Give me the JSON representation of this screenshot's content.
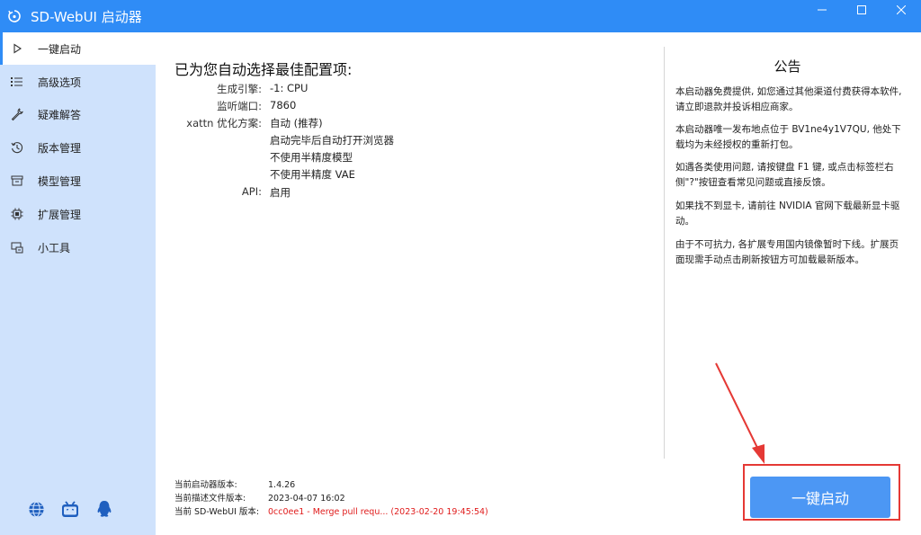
{
  "window": {
    "title": "SD-WebUI 启动器",
    "app_icon": "refresh-gear-icon",
    "controls": [
      "minimize",
      "maximize",
      "close"
    ],
    "accent_color": "#2f8cf6"
  },
  "sidebar": {
    "items": [
      {
        "label": "一键启动",
        "icon": "play-icon",
        "active": true
      },
      {
        "label": "高级选项",
        "icon": "list-icon",
        "active": false
      },
      {
        "label": "疑难解答",
        "icon": "wrench-icon",
        "active": false
      },
      {
        "label": "版本管理",
        "icon": "history-icon",
        "active": false
      },
      {
        "label": "模型管理",
        "icon": "box-icon",
        "active": false
      },
      {
        "label": "扩展管理",
        "icon": "chip-icon",
        "active": false
      },
      {
        "label": "小工具",
        "icon": "tools-icon",
        "active": false
      }
    ],
    "footer_icons": [
      "globe-icon",
      "bilibili-icon",
      "qq-icon"
    ]
  },
  "main": {
    "headline": "已为您自动选择最佳配置项:",
    "config": {
      "engine_key": "生成引擎:",
      "engine_val": "-1: CPU",
      "port_key": "监听端口:",
      "port_val": "7860",
      "xattn_key": "xattn 优化方案:",
      "xattn_val": "自动 (推荐)",
      "extra1": "启动完毕后自动打开浏览器",
      "extra2": "不使用半精度模型",
      "extra3": "不使用半精度 VAE",
      "api_key": "API:",
      "api_val": "启用"
    },
    "versions": {
      "launcher_key": "当前启动器版本:",
      "launcher_val": "1.4.26",
      "desc_key": "当前描述文件版本:",
      "desc_val": "2023-04-07 16:02",
      "sd_key": "当前 SD-WebUI 版本:",
      "sd_val": "0cc0ee1 - Merge pull requ... (2023-02-20 19:45:54)",
      "sd_val_color": "#e01c1c"
    }
  },
  "notice": {
    "title": "公告",
    "paragraphs": [
      "本启动器免费提供, 如您通过其他渠道付费获得本软件, 请立即退款并投诉相应商家。",
      "本启动器唯一发布地点位于 BV1ne4y1V7QU, 他处下载均为未经授权的重新打包。",
      "如遇各类使用问题, 请按键盘 F1 键, 或点击标签栏右侧\"?\"按钮查看常见问题或直接反馈。",
      "如果找不到显卡, 请前往 NVIDIA 官网下载最新显卡驱动。",
      "由于不可抗力, 各扩展专用国内镜像暂时下线。扩展页面现需手动点击刷新按钮方可加载最新版本。"
    ]
  },
  "launch_button": {
    "label": "一键启动",
    "color": "#4c97f4",
    "highlight_color": "#e53935"
  }
}
